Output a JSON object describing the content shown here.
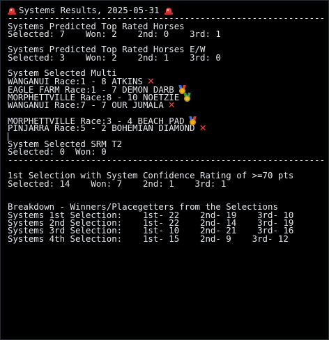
{
  "title": {
    "text": "Systems Results, 2025-05-31",
    "left_icon": "police-light-icon",
    "right_icon": "police-light-icon"
  },
  "divider": "-------------------------------------------------------------",
  "top_rated": {
    "heading": "Systems Predicted Top Rated Horses",
    "stats": "Selected: 7    Won: 2    2nd: 0    3rd: 1"
  },
  "top_rated_ew": {
    "heading": "Systems Predicted Top Rated Horses E/W",
    "stats": "Selected: 3    Won: 2    2nd: 1    3rd: 0"
  },
  "multi": {
    "heading": "System Selected Multi",
    "group1": [
      {
        "text": "WANGANUI Race:1 - 8 ATKINS",
        "result_icon": "cross-mark-icon"
      },
      {
        "text": "EAGLE FARM Race:1 - 7 DEMON DARB",
        "result_icon": "gold-medal-icon"
      },
      {
        "text": "MORPHETTVILLE Race:8 - 10 NOETZIE",
        "result_icon": "medal-icon"
      },
      {
        "text": "WANGANUI Race:7 - 7 OUR JUMALA",
        "result_icon": "cross-mark-icon"
      }
    ],
    "group2": [
      {
        "text": "MORPHETTVILLE Race:3 - 4 BEACH PAD",
        "result_icon": "gold-medal-icon"
      },
      {
        "text": "PINJARRA Race:5 - 2 BOHEMIAN DIAMOND",
        "result_icon": "cross-mark-icon"
      }
    ],
    "cross_glyph": "✕"
  },
  "srm": {
    "heading": "System Selected SRM T2",
    "stats": "Selected: 0  Won: 0"
  },
  "confidence": {
    "heading": "1st Selection with System Confidence Rating of >=70 pts",
    "stats": "Selected: 14    Won: 7    2nd: 1    3rd: 1"
  },
  "breakdown": {
    "heading": "Breakdown - Winners/Placegetters from the Selections",
    "rows": [
      "Systems 1st Selection:    1st- 22    2nd- 19    3rd- 10",
      "Systems 2nd Selection:    1st- 22    2nd- 14    3rd- 19",
      "Systems 3rd Selection:    1st- 10    2nd- 21    3rd- 16",
      "Systems 4th Selection:    1st- 15    2nd- 9    3rd- 12"
    ]
  },
  "colors": {
    "background": "#000000",
    "text": "#e3e7ec",
    "cross": "#f0413c",
    "medal_gold": "#f2b01e"
  }
}
